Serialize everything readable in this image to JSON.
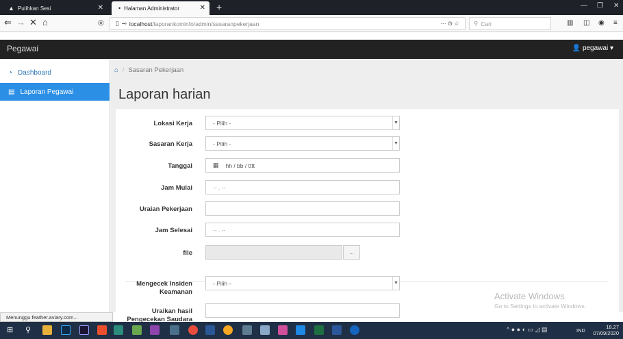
{
  "browser": {
    "tab1_label": "Pulihkan Sesi",
    "tab2_label": "Halaman Administrator",
    "new_tab": "+",
    "url_host": "localhost",
    "url_path": "/laporankominfo/admin/sasaranpekerjaan",
    "search_placeholder": "Cari",
    "url_more": "··· ⊙ ☆"
  },
  "app": {
    "brand": "Pegawai",
    "user_menu": "pegawai ▾"
  },
  "sidebar": {
    "items": [
      {
        "label": "Dashboard"
      },
      {
        "label": "Laporan Pegawai"
      }
    ]
  },
  "main": {
    "breadcrumb_sep": "/",
    "breadcrumb": "Sasaran Pekerjaan",
    "title": "Laporan harian"
  },
  "form": {
    "lokasi_label": "Lokasi Kerja",
    "lokasi_value": "- Pilih -",
    "sasaran_label": "Sasaran Kerja",
    "sasaran_value": "- Pilih -",
    "tanggal_label": "Tanggal",
    "tanggal_placeholder": "hh / bb / tttt",
    "jam_mulai_label": "Jam Mulai",
    "jam_mulai_placeholder": "-- . --",
    "uraian_label": "Uraian Pekerjaan",
    "jam_selesai_label": "Jam Selesai",
    "jam_selesai_placeholder": "-- . --",
    "file_label": "file",
    "browse_label": "...",
    "insiden_label": "Mengecek Insiden Keamanan",
    "insiden_value": "- Pilih -",
    "hasil_label": "Uraikan hasil Pengecekan Saudara"
  },
  "overlay": {
    "activate_title": "Activate Windows",
    "activate_sub": "Go to Settings to activate Windows."
  },
  "status_text": "Menunggu feather.aviary.com...",
  "taskbar": {
    "lang": "IND",
    "time": "18.27",
    "date": "07/09/2020"
  },
  "colors": {
    "accent": "#2a8fe5",
    "appbar": "#222222",
    "taskbar": "#1f2f45"
  }
}
